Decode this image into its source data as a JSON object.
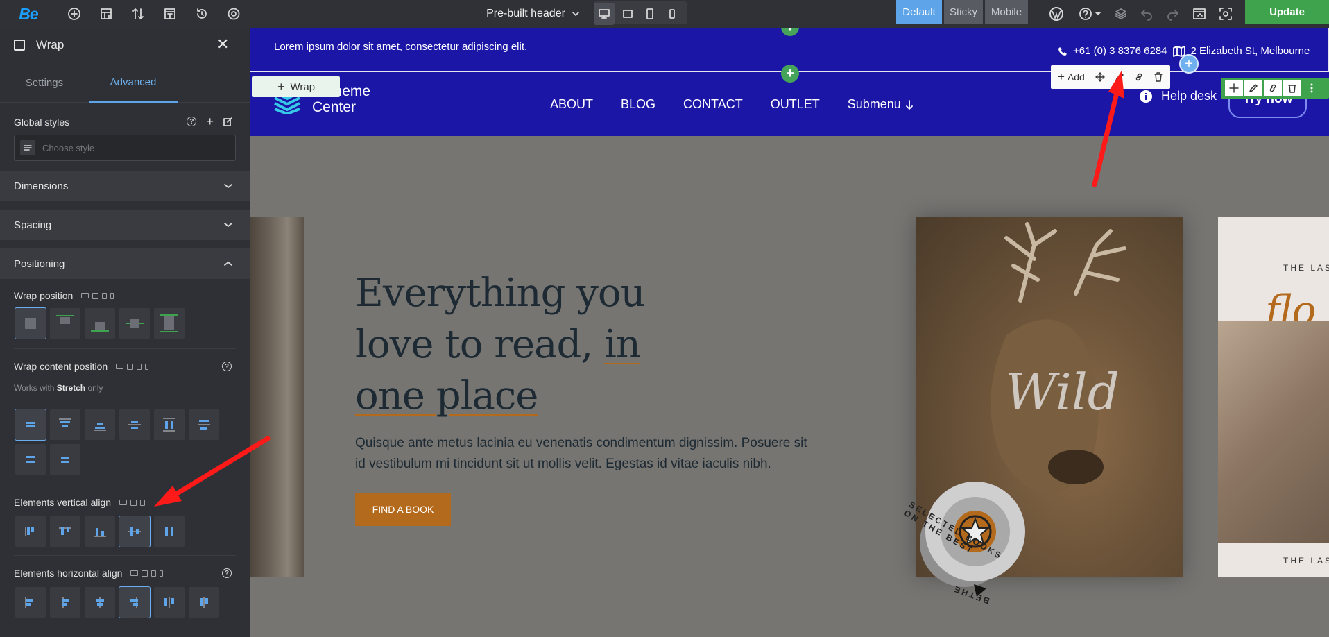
{
  "topbar": {
    "logo": "Be",
    "title": "Pre-built header",
    "states": [
      "Default",
      "Sticky",
      "Mobile"
    ],
    "active_state": "Default",
    "update_label": "Update",
    "icons": [
      "add-icon",
      "layout-icon",
      "sort-icon",
      "template-icon",
      "history-icon",
      "settings-icon",
      "wordpress-icon",
      "help-icon",
      "layers-icon",
      "undo-icon",
      "redo-icon",
      "preview-icon",
      "screenshot-icon"
    ]
  },
  "sidebar": {
    "title": "Wrap",
    "tabs": [
      "Settings",
      "Advanced"
    ],
    "active_tab": "Advanced",
    "global_styles": {
      "label": "Global styles",
      "placeholder": "Choose style"
    },
    "sections": [
      "Dimensions",
      "Spacing",
      "Positioning"
    ],
    "wrap_position_label": "Wrap position",
    "wrap_content_position_label": "Wrap content position",
    "works_with": {
      "prefix": "Works with",
      "bold": "Stretch",
      "suffix": "only"
    },
    "elements_vertical_align_label": "Elements vertical align",
    "elements_horizontal_align_label": "Elements horizontal align"
  },
  "canvas": {
    "top_text": "Lorem ipsum dolor sit amet, consectetur adipiscing elit.",
    "phone": "+61 (0) 3 8376 6284",
    "address": "2 Elizabeth St, Melbourne",
    "wrap_tag": "Wrap",
    "toolbar_add": "Add",
    "brand_line1": "Betheme",
    "brand_line2": "Center",
    "menu": [
      "ABOUT",
      "BLOG",
      "CONTACT",
      "OUTLET",
      "Submenu"
    ],
    "help_desk": "Help desk",
    "try_now": "Try now",
    "hero_title_1": "Everything you",
    "hero_title_2a": "love to read, ",
    "hero_title_2b": "in",
    "hero_title_3": "one place",
    "hero_text": "Quisque ante metus lacinia eu venenatis condimentum dignissim. Posuere sit id vestibulum mi tincidunt sit ut mollis velit. Egestas id vitae iaculis nibh.",
    "find_button": "FIND A BOOK",
    "book_word": "Wild",
    "badge_text": "SELECTED BOOKS ON THE BEST",
    "badge_bottom": "BETHE",
    "book3_top": "THE LAS",
    "book3_script": "flo",
    "book3_bottom": "THE LAS"
  },
  "colors": {
    "accent": "#5da5e8",
    "header_bg": "#1c16a7",
    "update_green": "#3fa34d",
    "cta_orange": "#b46a1c",
    "arrow_red": "#ff1a1a"
  }
}
